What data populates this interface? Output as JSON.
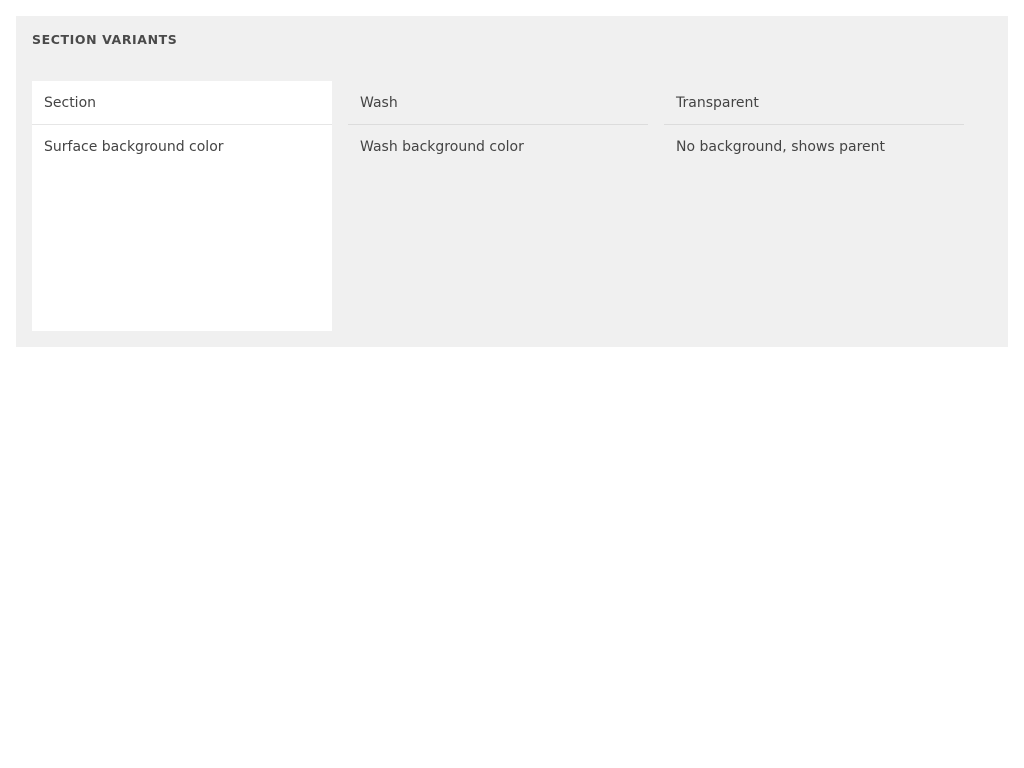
{
  "panel": {
    "title": "SECTION VARIANTS"
  },
  "variants": [
    {
      "header": "Section",
      "body": "Surface background color"
    },
    {
      "header": "Wash",
      "body": "Wash background color"
    },
    {
      "header": "Transparent",
      "body": "No background, shows parent"
    }
  ],
  "colors": {
    "page_background": "#ffffff",
    "panel_background": "#f0f0f0",
    "section_surface": "#ffffff",
    "wash_background": "#f0f0f0",
    "text": "#444444",
    "divider": "#dcdcdc"
  }
}
